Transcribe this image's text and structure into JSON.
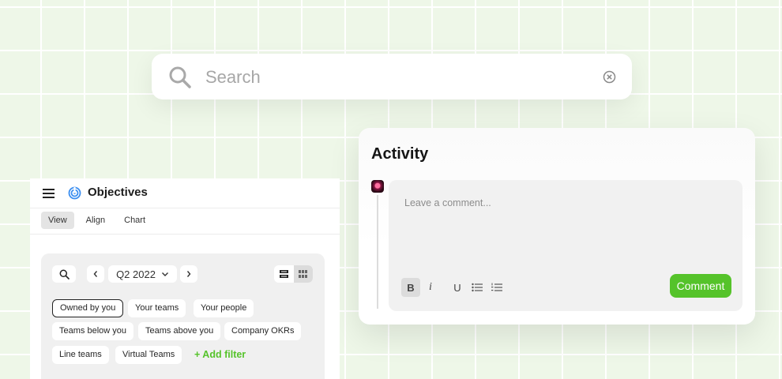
{
  "search": {
    "placeholder": "Search"
  },
  "activity": {
    "title": "Activity",
    "comment_placeholder": "Leave a comment...",
    "toolbar": {
      "bold": "B",
      "italic": "i",
      "underline": "U"
    },
    "submit_label": "Comment"
  },
  "objectives": {
    "title": "Objectives",
    "tabs": [
      {
        "label": "View",
        "active": true
      },
      {
        "label": "Align",
        "active": false
      },
      {
        "label": "Chart",
        "active": false
      }
    ],
    "quarter": "Q2 2022",
    "filters": [
      {
        "label": "Owned by you",
        "selected": true
      },
      {
        "label": "Your teams",
        "selected": false
      },
      {
        "label": "Your people",
        "selected": false
      },
      {
        "label": "Teams below you",
        "selected": false
      },
      {
        "label": "Teams above you",
        "selected": false
      },
      {
        "label": "Company OKRs",
        "selected": false
      },
      {
        "label": "Line teams",
        "selected": false
      },
      {
        "label": "Virtual Teams",
        "selected": false
      }
    ],
    "add_filter_label": "+ Add filter"
  },
  "colors": {
    "accent_green": "#55c32a",
    "target_blue": "#3b8ef0",
    "grid_background": "#eef7e8"
  },
  "icons": [
    "search-icon",
    "clear-circle-icon",
    "hamburger-menu-icon",
    "target-icon",
    "chevron-left-icon",
    "chevron-right-icon",
    "chevron-down-icon",
    "list-view-icon",
    "grid-view-icon",
    "bullet-list-icon",
    "numbered-list-icon"
  ]
}
